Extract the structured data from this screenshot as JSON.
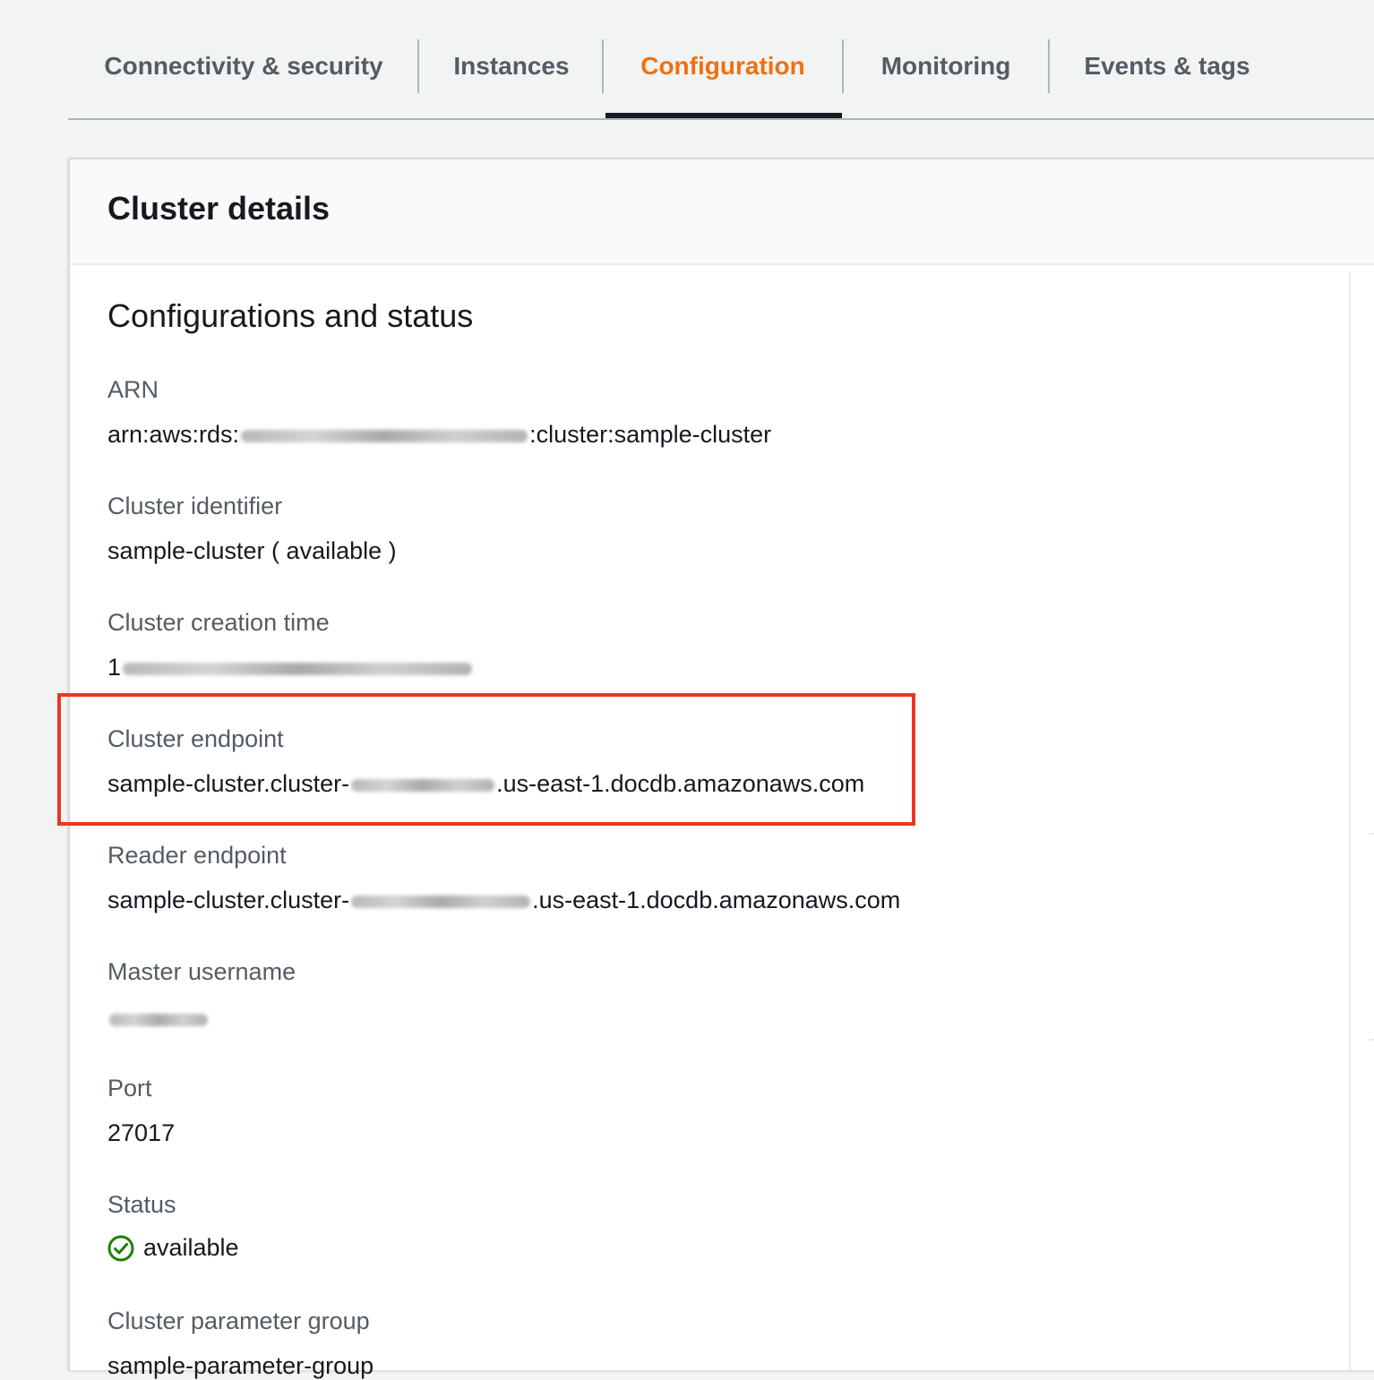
{
  "tabs": [
    {
      "label": "Connectivity & security",
      "active": false
    },
    {
      "label": "Instances",
      "active": false
    },
    {
      "label": "Configuration",
      "active": true
    },
    {
      "label": "Monitoring",
      "active": false
    },
    {
      "label": "Events & tags",
      "active": false
    }
  ],
  "colors": {
    "accent": "#ec7211",
    "tab_text": "#545b64",
    "highlight": "#ee3524",
    "status_ok": "#1d8102"
  },
  "card": {
    "title": "Cluster details",
    "section_title": "Configurations and status",
    "fields": {
      "arn": {
        "label": "ARN",
        "value_prefix": "arn:aws:rds:",
        "value_suffix": ":cluster:sample-cluster"
      },
      "cluster_identifier": {
        "label": "Cluster identifier",
        "value": "sample-cluster ( available )"
      },
      "creation_time": {
        "label": "Cluster creation time",
        "value_prefix": "1"
      },
      "cluster_endpoint": {
        "label": "Cluster endpoint",
        "value_prefix": "sample-cluster.cluster-",
        "value_suffix": ".us-east-1.docdb.amazonaws.com"
      },
      "reader_endpoint": {
        "label": "Reader endpoint",
        "value_prefix": "sample-cluster.cluster-",
        "value_suffix": ".us-east-1.docdb.amazonaws.com"
      },
      "master_username": {
        "label": "Master username"
      },
      "port": {
        "label": "Port",
        "value": "27017"
      },
      "status": {
        "label": "Status",
        "value": "available",
        "icon": "check-circle-icon"
      },
      "parameter_group": {
        "label": "Cluster parameter group",
        "value": "sample-parameter-group"
      }
    }
  }
}
